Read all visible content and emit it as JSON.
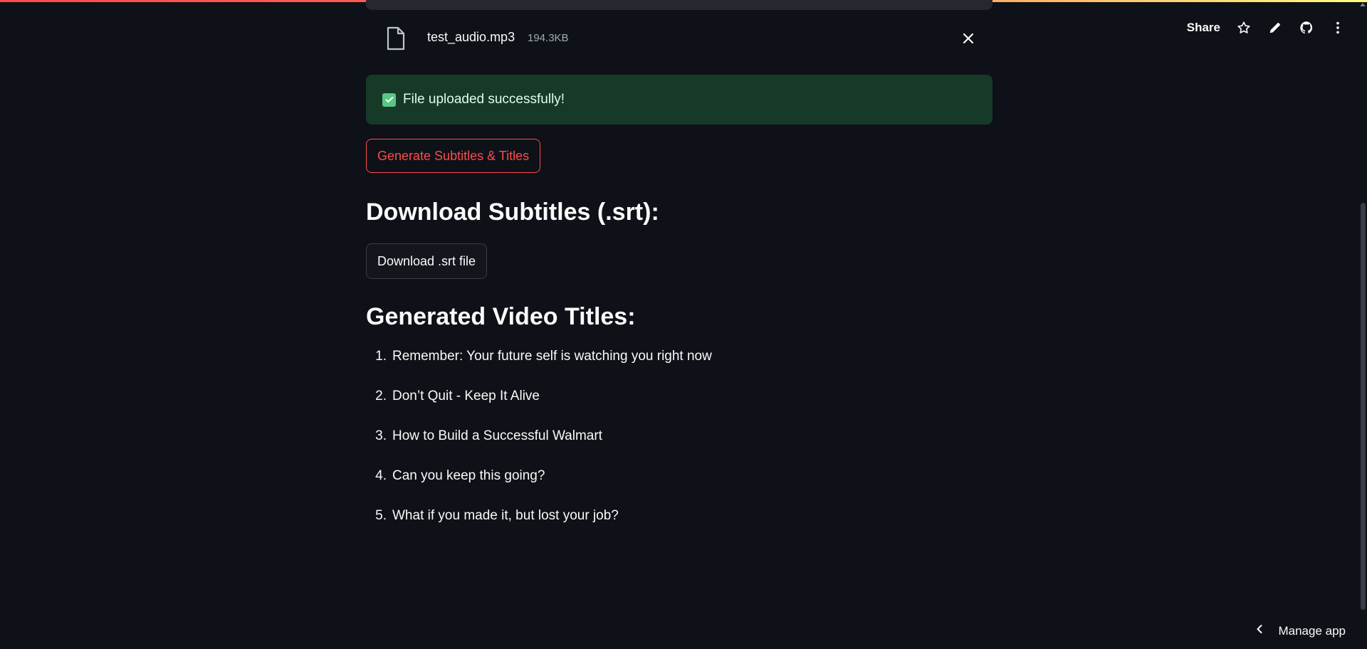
{
  "toolbar": {
    "share_label": "Share",
    "icons": [
      "star-icon",
      "pencil-icon",
      "github-icon",
      "more-vertical-icon"
    ]
  },
  "uploader": {
    "file_name": "test_audio.mp3",
    "file_size": "194.3KB"
  },
  "success": {
    "message": "File uploaded successfully!",
    "color": "#173928"
  },
  "generate_button": {
    "label": "Generate Subtitles & Titles",
    "color": "#ff4b4b"
  },
  "subtitles_section": {
    "heading": "Download Subtitles (.srt):",
    "download_label": "Download .srt file"
  },
  "titles_section": {
    "heading": "Generated Video Titles:",
    "items": [
      {
        "number": "1",
        "text": "Remember: Your future self is watching you right now"
      },
      {
        "number": "2",
        "text": "Don’t Quit - Keep It Alive"
      },
      {
        "number": "3",
        "text": "How to Build a Successful Walmart"
      },
      {
        "number": "4",
        "text": "Can you keep this going?"
      },
      {
        "number": "5",
        "text": "What if you made it, but lost your job?"
      }
    ]
  },
  "footer": {
    "manage_app_label": "Manage app"
  },
  "colors": {
    "background": "#0e1117",
    "accent": "#ff4b4b"
  }
}
